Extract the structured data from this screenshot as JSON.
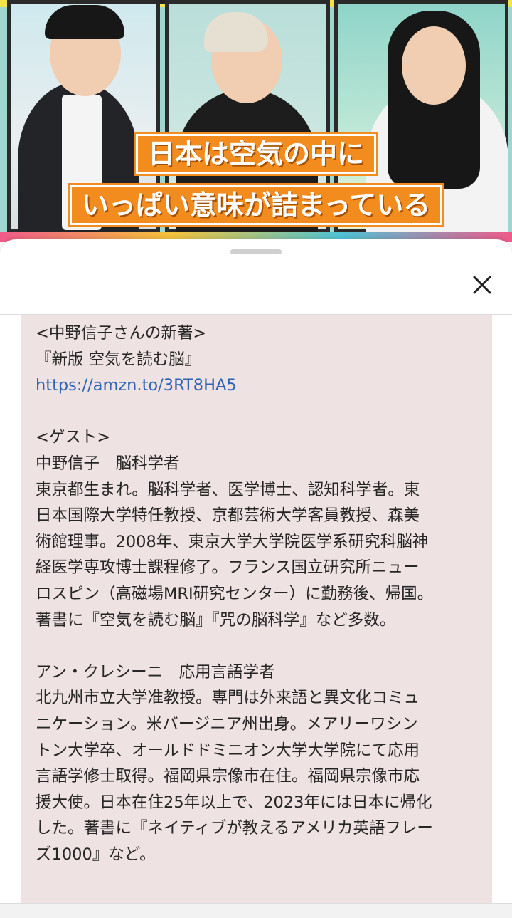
{
  "video": {
    "caption_line1": "日本は空気の中に",
    "caption_line2": "いっぱい意味が詰まっている"
  },
  "sheet": {
    "close_icon": "close-icon",
    "description": {
      "book_heading": "<中野信子さんの新著>",
      "book_title": "『新版 空気を読む脳』",
      "book_link": "https://amzn.to/3RT8HA5",
      "guest_heading": "<ゲスト>",
      "guest1_name_line": "中野信子　脳科学者",
      "guest1_bio_lines": [
        "東京都生まれ。脳科学者、医学博士、認知科学者。東",
        "日本国際大学特任教授、京都芸術大学客員教授、森美",
        "術館理事。2008年、東京大学大学院医学系研究科脳神",
        "経医学専攻博士課程修了。フランス国立研究所ニュー",
        "ロスピン（高磁場MRI研究センター）に勤務後、帰国。",
        "著書に『空気を読む脳』『咒の脳科学』など多数。"
      ],
      "guest2_name_line": "アン・クレシーニ　応用言語学者",
      "guest2_bio_lines": [
        "北九州市立大学准教授。専門は外来語と異文化コミュ",
        "ニケーション。米バージニア州出身。メアリーワシン",
        "トン大学卒、オールドドミニオン大学大学院にて応用",
        "言語学修士取得。福岡県宗像市在住。福岡県宗像市応",
        "援大使。日本在住25年以上で、2023年には日本に帰化",
        "した。著書に『ネイティブが教えるアメリカ英語フレー",
        "ズ1000』など。"
      ]
    }
  }
}
